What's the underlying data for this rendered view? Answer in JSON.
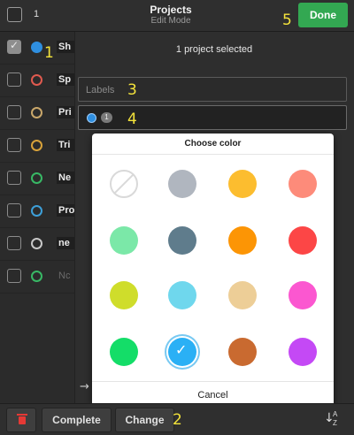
{
  "header": {
    "selected_count": "1",
    "title": "Projects",
    "subtitle": "Edit Mode",
    "done_label": "Done"
  },
  "callouts": [
    "1",
    "2",
    "3",
    "4",
    "5"
  ],
  "projects": [
    {
      "name": "Sh",
      "color": "#2f8fe0",
      "checked": true
    },
    {
      "name": "Sp",
      "color": "#e05a4f",
      "checked": false
    },
    {
      "name": "Pri",
      "color": "#c9a76a",
      "checked": false
    },
    {
      "name": "Tri",
      "color": "#d8a23a",
      "checked": false
    },
    {
      "name": "Ne",
      "color": "#38b865",
      "checked": false
    },
    {
      "name": "Pro",
      "color": "#3d9fd8",
      "checked": false
    },
    {
      "name": "ne",
      "color": "#c8c8c8",
      "checked": false
    },
    {
      "name": "Nc",
      "color": "#38b865",
      "checked": false
    }
  ],
  "panel": {
    "selected_text": "1 project selected",
    "labels_placeholder": "Labels",
    "color_count": "1"
  },
  "color_picker": {
    "title": "Choose color",
    "cancel_label": "Cancel",
    "colors": [
      {
        "name": "no-color",
        "hex": ""
      },
      {
        "name": "grey",
        "hex": "#b0b6bf"
      },
      {
        "name": "yellow",
        "hex": "#fcbd2f"
      },
      {
        "name": "salmon",
        "hex": "#fd8b7a"
      },
      {
        "name": "mint",
        "hex": "#7be8a8"
      },
      {
        "name": "slate",
        "hex": "#5f7c8c"
      },
      {
        "name": "orange",
        "hex": "#fc9505"
      },
      {
        "name": "red",
        "hex": "#fc4646"
      },
      {
        "name": "lime",
        "hex": "#cfdd2b"
      },
      {
        "name": "sky",
        "hex": "#6fd7ed"
      },
      {
        "name": "tan",
        "hex": "#edce97"
      },
      {
        "name": "pink",
        "hex": "#fb57d0"
      },
      {
        "name": "green",
        "hex": "#14dd68"
      },
      {
        "name": "blue",
        "hex": "#2ab0f5",
        "selected": true
      },
      {
        "name": "brown",
        "hex": "#c96a30"
      },
      {
        "name": "purple",
        "hex": "#c449f5"
      }
    ]
  },
  "footer": {
    "complete_label": "Complete",
    "change_label": "Change",
    "sort_a": "A",
    "sort_z": "Z"
  },
  "icons": {
    "arrow": "→",
    "sort": "↓"
  },
  "colors": {
    "done_green": "#33a852",
    "callout_yellow": "#f4e33b",
    "trash_red": "#e53935"
  }
}
